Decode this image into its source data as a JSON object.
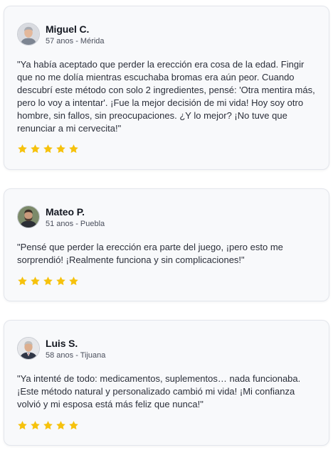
{
  "colors": {
    "star": "#f6c20d",
    "card_bg": "#f8f9fb",
    "card_border": "#e3e6ec"
  },
  "rating_max": 5,
  "reviews": [
    {
      "name": "Miguel C.",
      "meta": "57 anos - Mérida",
      "avatar_icon": "man-avatar-gray-hair",
      "rating": 5,
      "text": "\"Ya había aceptado que perder la erección era cosa de la edad. Fingir que no me dolía mientras escuchaba bromas era aún peor. Cuando descubrí este método con solo 2 ingredientes, pensé: 'Otra mentira más, pero lo voy a intentar'. ¡Fue la mejor decisión de mi vida! Hoy soy otro hombre, sin fallos, sin preocupaciones. ¿Y lo mejor? ¡No tuve que renunciar a mi cervecita!\""
    },
    {
      "name": "Mateo P.",
      "meta": "51 anos - Puebla",
      "avatar_icon": "man-avatar-dark-beard",
      "rating": 5,
      "text": "\"Pensé que perder la erección era parte del juego, ¡pero esto me sorprendió! ¡Realmente funciona y sin complicaciones!\""
    },
    {
      "name": "Luis S.",
      "meta": "58 anos - Tijuana",
      "avatar_icon": "man-avatar-suit",
      "rating": 5,
      "text": "\"Ya intenté de todo: medicamentos, suplementos… nada funcionaba. ¡Este método natural y personalizado cambió mi vida! ¡Mi confianza volvió y mi esposa está más feliz que nunca!\""
    }
  ]
}
